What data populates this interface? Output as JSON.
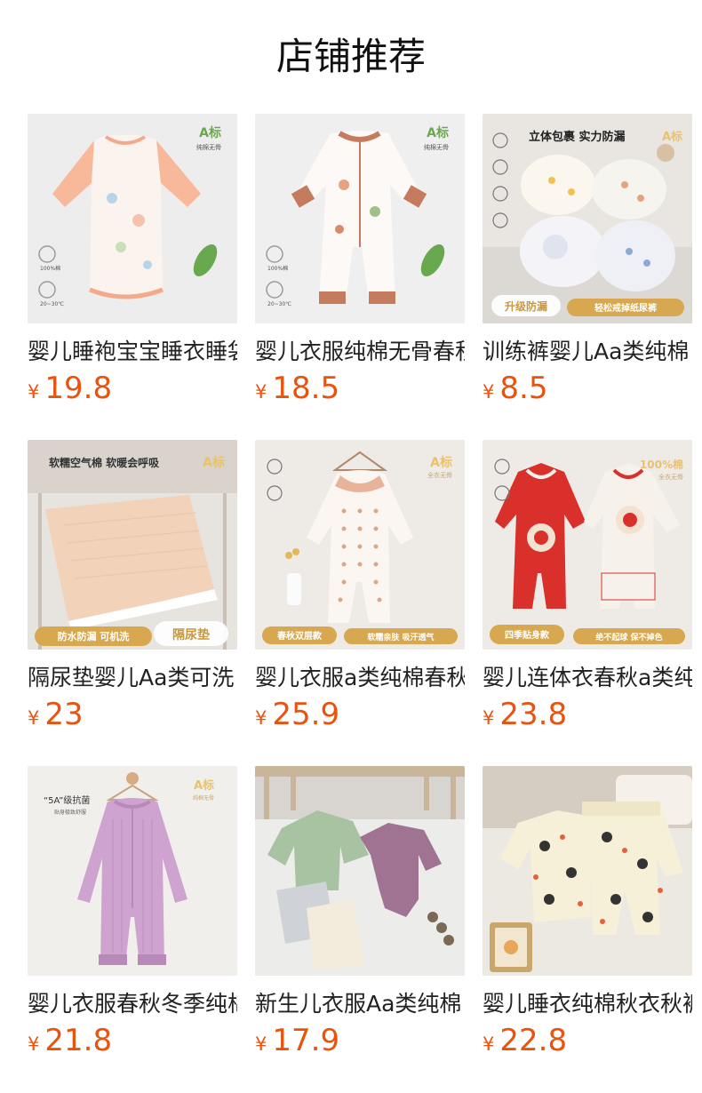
{
  "section": {
    "title": "店铺推荐"
  },
  "currency": "¥",
  "products": [
    {
      "title": "婴儿睡袍宝宝睡衣睡袋",
      "price": "19.8",
      "image_text": {
        "badge": "A标",
        "sub": "纯棉无骨",
        "tag_a": "100%棉",
        "tag_b": "20~30℃"
      },
      "icon": "sleep-gown-image"
    },
    {
      "title": "婴儿衣服纯棉无骨春秋",
      "price": "18.5",
      "image_text": {
        "badge": "A标",
        "sub": "纯棉无骨",
        "tag_a": "100%棉",
        "tag_b": "20~30℃"
      },
      "icon": "romper-image"
    },
    {
      "title": "训练裤婴儿Aa类纯棉",
      "price": "8.5",
      "image_text": {
        "top": "立体包裹 实力防漏",
        "badge": "A标",
        "left": "升级防漏",
        "right": "轻松戒掉纸尿裤"
      },
      "icon": "training-pants-image"
    },
    {
      "title": "隔尿垫婴儿Aa类可洗",
      "price": "23",
      "image_text": {
        "top": "软糯空气棉 软暖会呼吸",
        "badge": "A标",
        "left": "防水防漏 可机洗",
        "right": "隔尿垫"
      },
      "icon": "diaper-pad-image"
    },
    {
      "title": "婴儿衣服a类纯棉春秋",
      "price": "25.9",
      "image_text": {
        "badge": "A标",
        "sub": "全衣无骨",
        "left": "春秋双层款",
        "right": "软糯亲肤 吸汗透气"
      },
      "icon": "collar-romper-image"
    },
    {
      "title": "婴儿连体衣春秋a类纯",
      "price": "23.8",
      "image_text": {
        "badge": "100%棉",
        "sub": "全衣无骨",
        "left": "四季贴身款",
        "right": "绝不起球 保不掉色"
      },
      "icon": "red-romper-image"
    },
    {
      "title": "婴儿衣服春秋冬季纯棉",
      "price": "21.8",
      "image_text": {
        "badge": "A标",
        "sub": "纯棉无骨",
        "top": "“5A”级抗菌",
        "top_sub": "贴身极致舒服"
      },
      "icon": "pink-romper-image"
    },
    {
      "title": "新生儿衣服Aa类纯棉",
      "price": "17.9",
      "image_text": {},
      "icon": "newborn-set-image"
    },
    {
      "title": "婴儿睡衣纯棉秋衣秋裤",
      "price": "22.8",
      "image_text": {},
      "icon": "panda-pajama-image"
    }
  ]
}
